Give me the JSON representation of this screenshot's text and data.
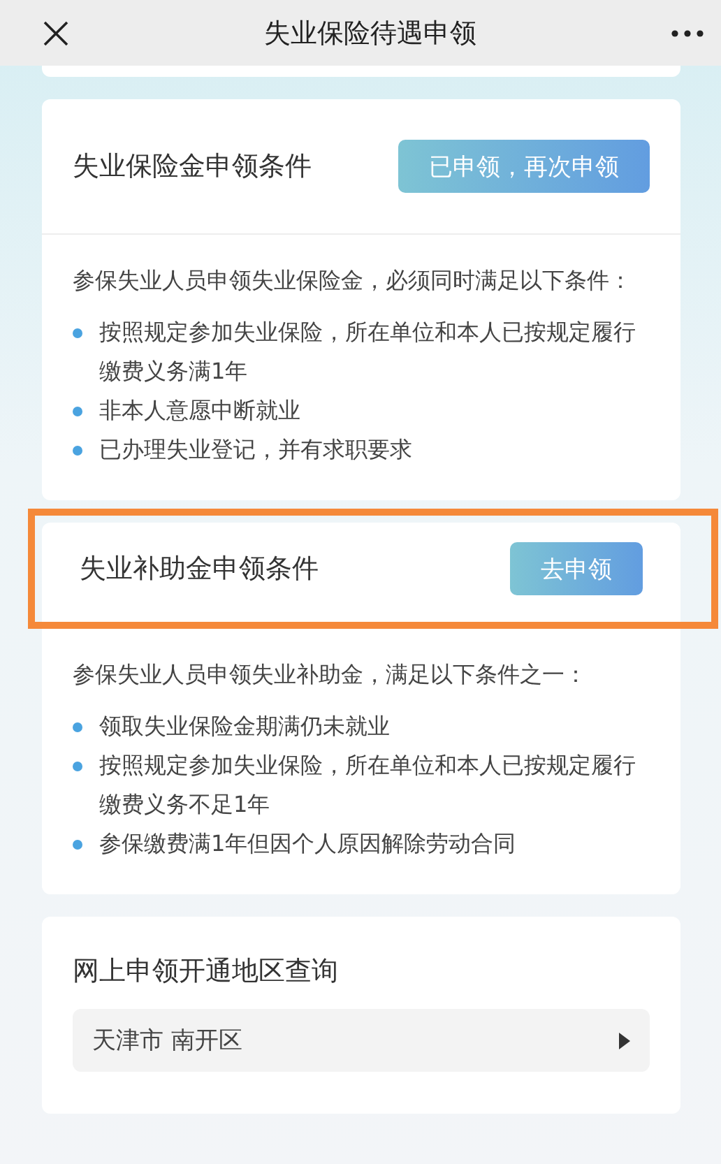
{
  "nav_bar": {
    "title": "失业保险待遇申领"
  },
  "sections": [
    {
      "title": "失业保险金申领条件",
      "button": "已申领，再次申领",
      "highlighted": false,
      "intro": "参保失业人员申领失业保险金，必须同时满足以下条件：",
      "conditions": [
        "按照规定参加失业保险，所在单位和本人已按规定履行缴费义务满1年",
        "非本人意愿中断就业",
        "已办理失业登记，并有求职要求"
      ]
    },
    {
      "title": "失业补助金申领条件",
      "button": "去申领",
      "highlighted": true,
      "intro": "参保失业人员申领失业补助金，满足以下条件之一：",
      "conditions": [
        "领取失业保险金期满仍未就业",
        "按照规定参加失业保险，所在单位和本人已按规定履行缴费义务不足1年",
        "参保缴费满1年但因个人原因解除劳动合同"
      ]
    }
  ],
  "region_query": {
    "title": "网上申领开通地区查询",
    "value": "天津市 南开区"
  }
}
